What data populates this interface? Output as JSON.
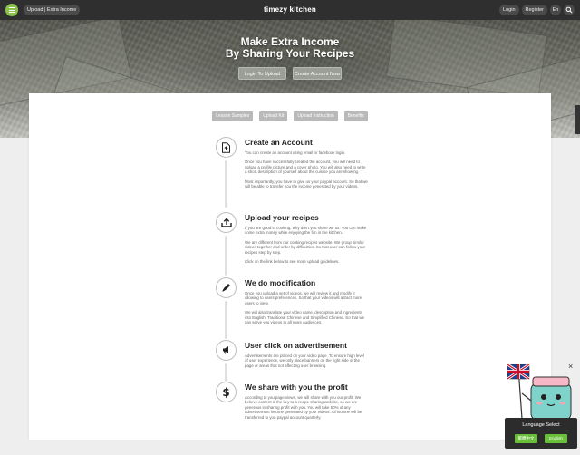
{
  "nav": {
    "breadcrumb": "Upload | Extra Income",
    "brand": "timezy kitchen",
    "login": "Login",
    "register": "Register",
    "language_short": "En"
  },
  "hero": {
    "title_line1": "Make Extra Income",
    "title_line2": "By Sharing Your Recipes",
    "login_upload": "Login To Upload",
    "create_account": "Create Account Now"
  },
  "tabs": [
    "Lesson Samples",
    "Upload Kit",
    "Upload Instruction",
    "Benefits"
  ],
  "steps": [
    {
      "icon": "upload-file-icon",
      "title": "Create an Account",
      "paragraphs": [
        "You can create an account using email or facebook login.",
        "Once you have successfully created the account, you will need to upload a profile picture and a cover photo. You will also need to write a short description of yourself about the cuisine you are showing.",
        "Most importantly, you have to give us your paypal account. So that we will be able to transfer you the income generated by your videos."
      ]
    },
    {
      "icon": "upload-icon",
      "title": "Upload your recipes",
      "paragraphs": [
        "If you are good in cooking, why don't you share we us. You can make some extra money while enjoying the fun in the kitchen.",
        "We are different from our cooking recipes website. We group similar videos together and order by difficulties. So that user can follow your recipes step by step.",
        "Click on the link below to see more upload guidelines."
      ]
    },
    {
      "icon": "pencil-icon",
      "title": "We do modification",
      "paragraphs": [
        "Once you upload a set of videos, we will review it and modify it allowing to users preferences. So that your videos will attract more users to view.",
        "We will also translate your video name, description and ingredients into English, Traditional Chinese and Simplified Chinese. So that we can serve you videos to all more audiences."
      ]
    },
    {
      "icon": "megaphone-icon",
      "title": "User click on advertisement",
      "paragraphs": [
        "Advertisements are placed on your video page. To ensure high level of user experience, we only place banners on the right side of the page or areas that not affecting user browsing."
      ]
    },
    {
      "icon": "dollar-icon",
      "title": "We share with you the profit",
      "paragraphs": [
        "According to you page views, we will share with you our profit. We believe content is the key to a recipe sharing website, so we are generous in sharing profit with you. You will take 50% of any advertisement income generated by your videos. All income will be transferred to you paypal account quarterly."
      ]
    }
  ],
  "language_widget": {
    "title": "Language Select",
    "option_chinese": "繁體中文",
    "option_english": "English",
    "close": "×"
  },
  "colors": {
    "accent_green": "#8bc34a",
    "nav_dark": "#2f2f2f",
    "tab_gray": "#b9b9b9"
  }
}
